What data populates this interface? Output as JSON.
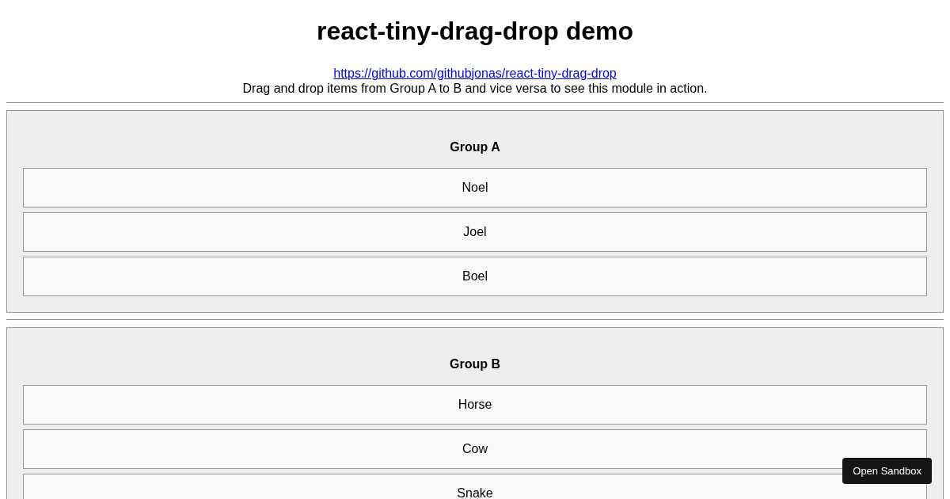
{
  "title": "react-tiny-drag-drop demo",
  "link": "https://github.com/githubjonas/react-tiny-drag-drop",
  "description": "Drag and drop items from Group A to B and vice versa to see this module in action.",
  "groups": [
    {
      "title": "Group A",
      "items": [
        "Noel",
        "Joel",
        "Boel"
      ]
    },
    {
      "title": "Group B",
      "items": [
        "Horse",
        "Cow",
        "Snake"
      ]
    }
  ],
  "sandbox_button": "Open Sandbox"
}
